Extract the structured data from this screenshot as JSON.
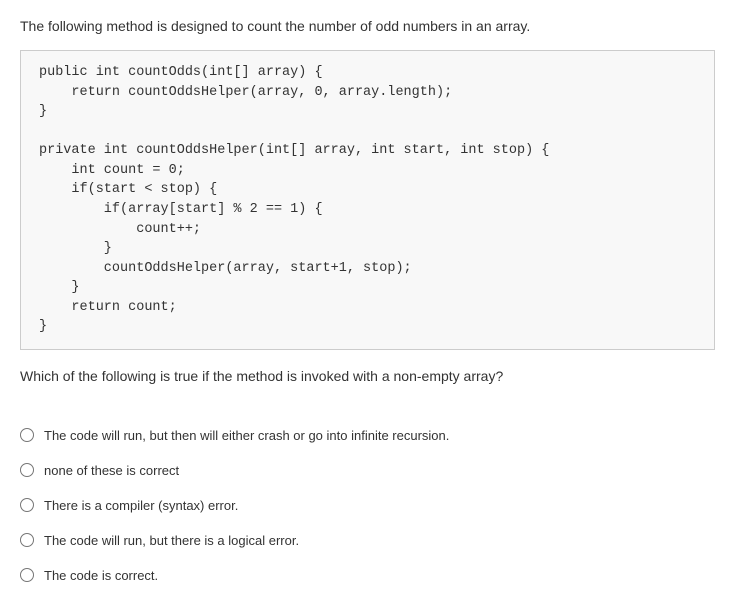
{
  "intro": "The following method is designed to count the number of odd numbers in an array.",
  "code": "public int countOdds(int[] array) {\n    return countOddsHelper(array, 0, array.length);\n}\n\nprivate int countOddsHelper(int[] array, int start, int stop) {\n    int count = 0;\n    if(start < stop) {\n        if(array[start] % 2 == 1) {\n            count++;\n        }\n        countOddsHelper(array, start+1, stop);\n    }\n    return count;\n}",
  "prompt": "Which of the following is true if the method is invoked with a non-empty array?",
  "options": [
    "The code will run, but then will either crash or go into infinite recursion.",
    "none of these is correct",
    "There is a compiler (syntax) error.",
    "The code will run, but there is a logical error.",
    "The code is correct."
  ]
}
